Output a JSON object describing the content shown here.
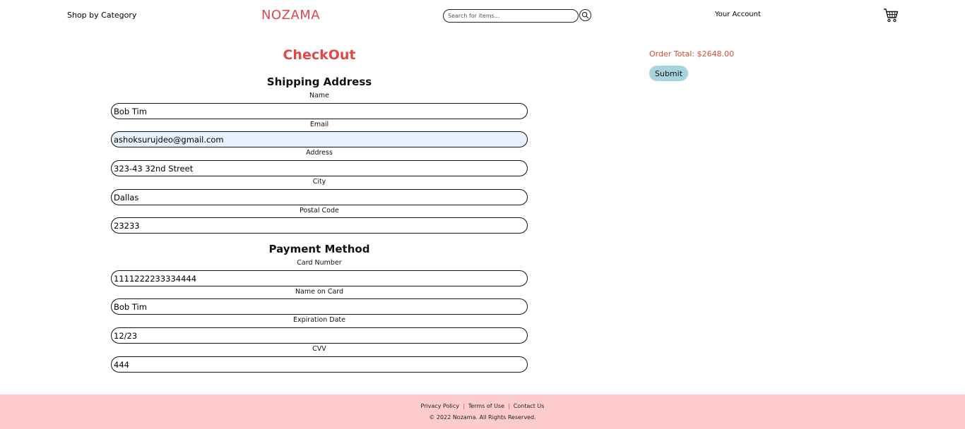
{
  "header": {
    "shop_by_category": "Shop by Category",
    "logo": "NOZAMA",
    "search_placeholder": "Search for items...",
    "account": "Your Account",
    "search_icon": "search-icon",
    "cart_icon": "shopping-cart-icon"
  },
  "checkout": {
    "title": "CheckOut",
    "shipping": {
      "title": "Shipping Address",
      "fields": [
        {
          "label": "Name",
          "value": "Bob Tim"
        },
        {
          "label": "Email",
          "value": "ashoksurujdeo@gmail.com"
        },
        {
          "label": "Address",
          "value": "323-43 32nd Street"
        },
        {
          "label": "City",
          "value": "Dallas"
        },
        {
          "label": "Postal Code",
          "value": "23233"
        }
      ]
    },
    "payment": {
      "title": "Payment Method",
      "fields": [
        {
          "label": "Card Number",
          "value": "1111222233334444"
        },
        {
          "label": "Name on Card",
          "value": "Bob Tim"
        },
        {
          "label": "Expiration Date",
          "value": "12/23"
        },
        {
          "label": "CVV",
          "value": "444"
        }
      ]
    }
  },
  "summary": {
    "order_total": "Order Total: $2648.00",
    "submit_label": "Submit"
  },
  "footer": {
    "privacy": "Privacy Policy",
    "terms": "Terms of Use",
    "contact": "Contact Us",
    "separator": "|",
    "copyright": "© 2022 Nozama. All Rights Reserved."
  },
  "colors": {
    "brand_red": "#e04848",
    "submit_button": "#a7d3de",
    "footer_bg": "#ffcccc",
    "autofill_bg": "#e8f0fe"
  }
}
